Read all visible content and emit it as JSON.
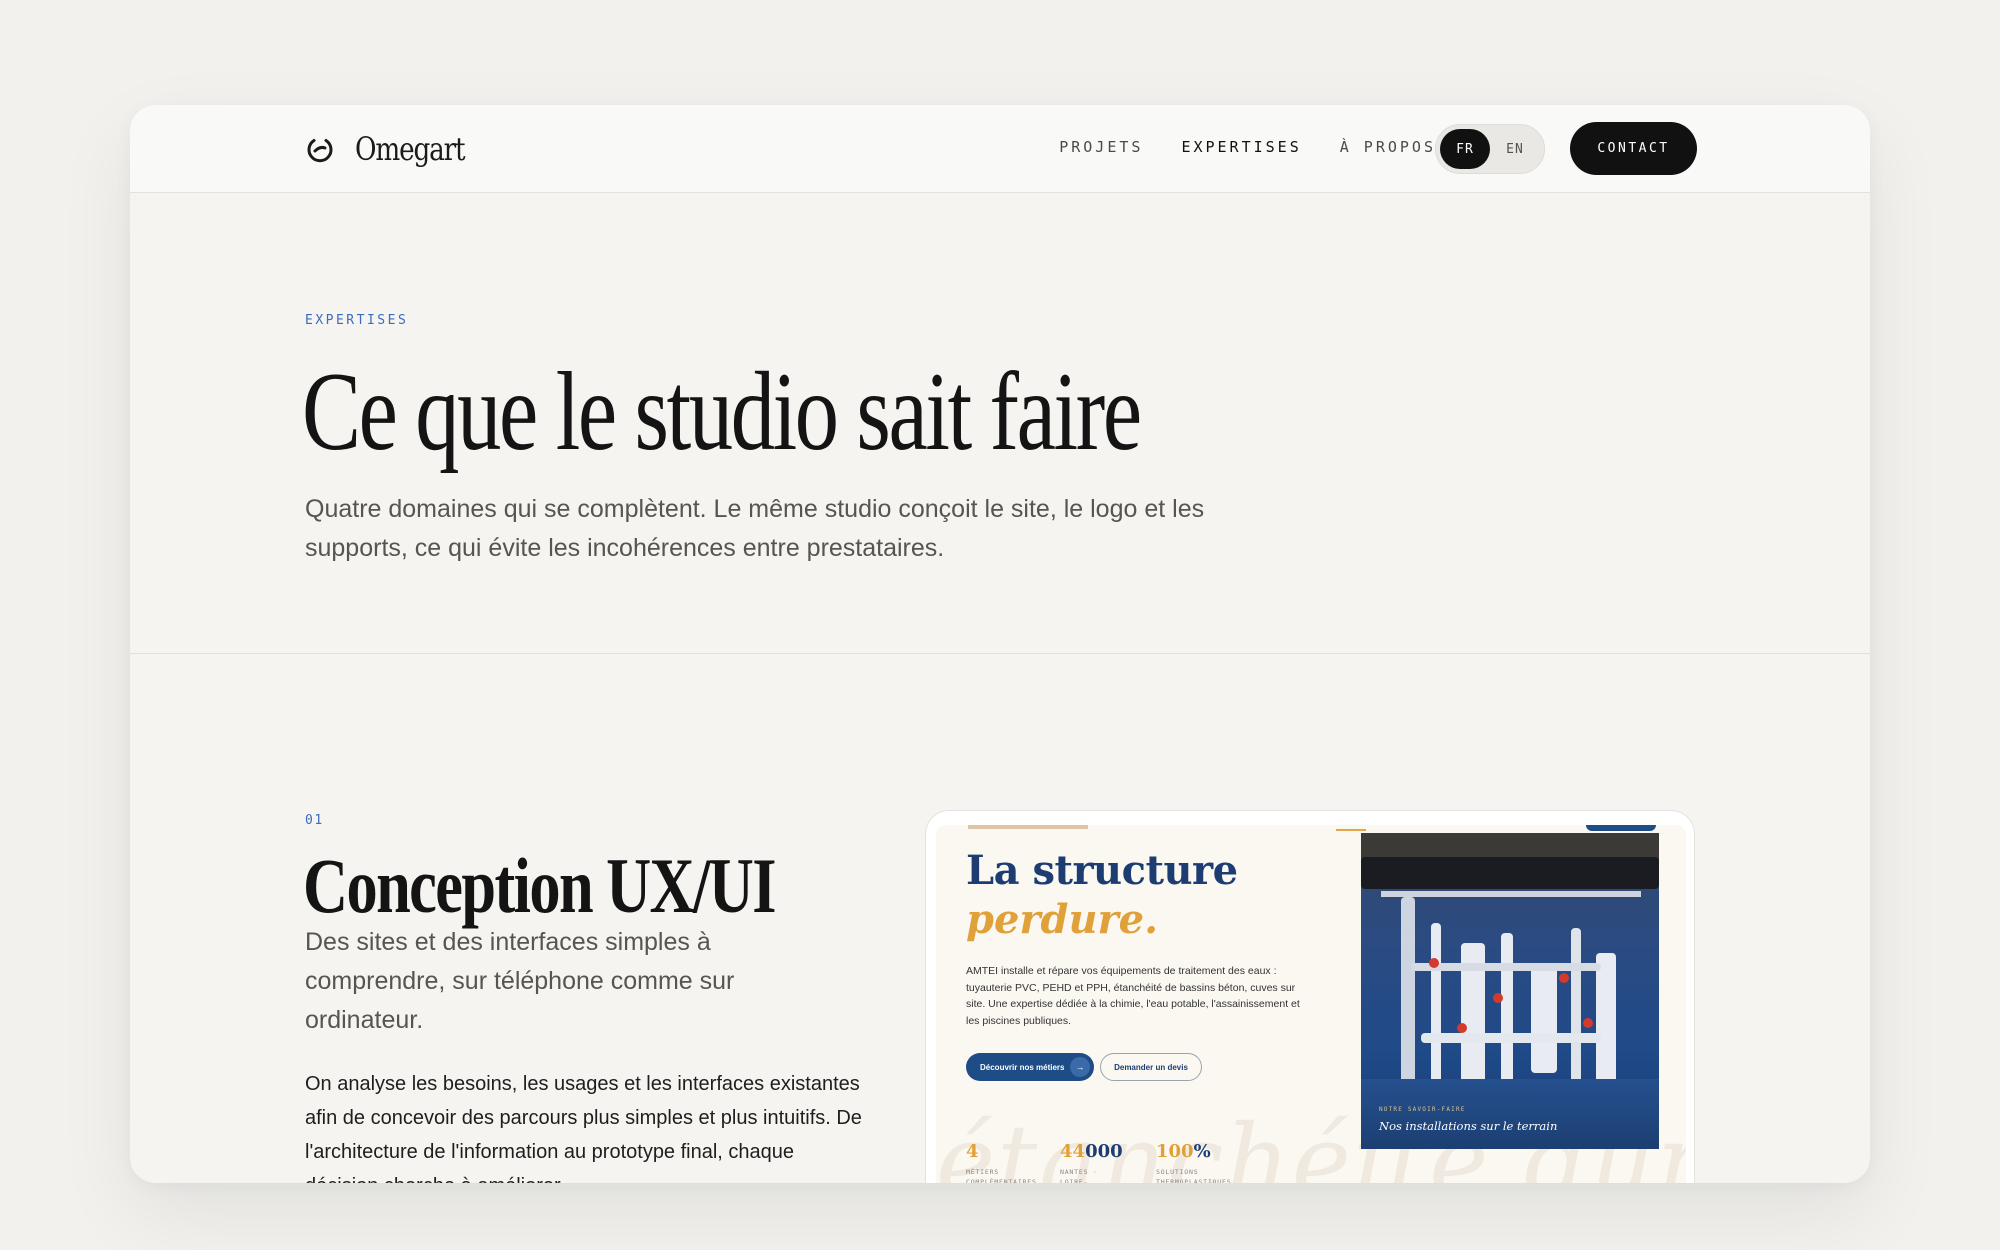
{
  "header": {
    "brand": "Omegart",
    "nav": [
      {
        "label": "PROJETS",
        "active": false
      },
      {
        "label": "EXPERTISES",
        "active": true
      },
      {
        "label": "À PROPOS",
        "active": false
      }
    ],
    "lang": {
      "fr": "FR",
      "en": "EN",
      "selected": "FR"
    },
    "contact": "CONTACT"
  },
  "intro": {
    "eyebrow": "EXPERTISES",
    "title": "Ce que le studio sait faire",
    "lead": "Quatre domaines qui se complètent. Le même studio conçoit le site, le logo et les supports, ce qui évite les incohérences entre prestataires."
  },
  "section": {
    "number": "01",
    "title": "Conception UX/UI",
    "subtitle": "Des sites et des interfaces simples à comprendre, sur téléphone comme sur ordinateur.",
    "body": "On analyse les besoins, les usages et les interfaces existantes afin de concevoir des parcours plus simples et plus intuitifs. De l'architecture de l'information au prototype final, chaque décision cherche à améliorer"
  },
  "preview": {
    "heading_line1": "La structure",
    "heading_line2": "perdure.",
    "paragraph": "AMTEI installe et répare vos équipements de traitement des eaux : tuyauterie PVC, PEHD et PPH, étanchéité de bassins béton, cuves sur site. Une expertise dédiée à la chimie, l'eau potable, l'assainissement et les piscines publiques.",
    "btn_primary": "Découvrir nos métiers",
    "btn_secondary": "Demander un devis",
    "watermark": "étanchéité dur",
    "photo_label": "NOTRE SAVOIR-FAIRE",
    "photo_caption": "Nos installations sur le terrain",
    "stats": [
      {
        "value_a": "4",
        "value_b": "",
        "label": "MÉTIERS COMPLÉMENTAIRES"
      },
      {
        "value_a": "44",
        "value_b": "000",
        "label": "NANTES · LOIRE-ATLANTIQUE"
      },
      {
        "value_a": "100",
        "value_b": "%",
        "label": "SOLUTIONS THERMOPLASTIQUES"
      }
    ]
  },
  "colors": {
    "accent_blue": "#3d6bbd",
    "brand_navy": "#1d3d72",
    "brand_gold": "#e0a13a",
    "button_dark": "#111111"
  }
}
